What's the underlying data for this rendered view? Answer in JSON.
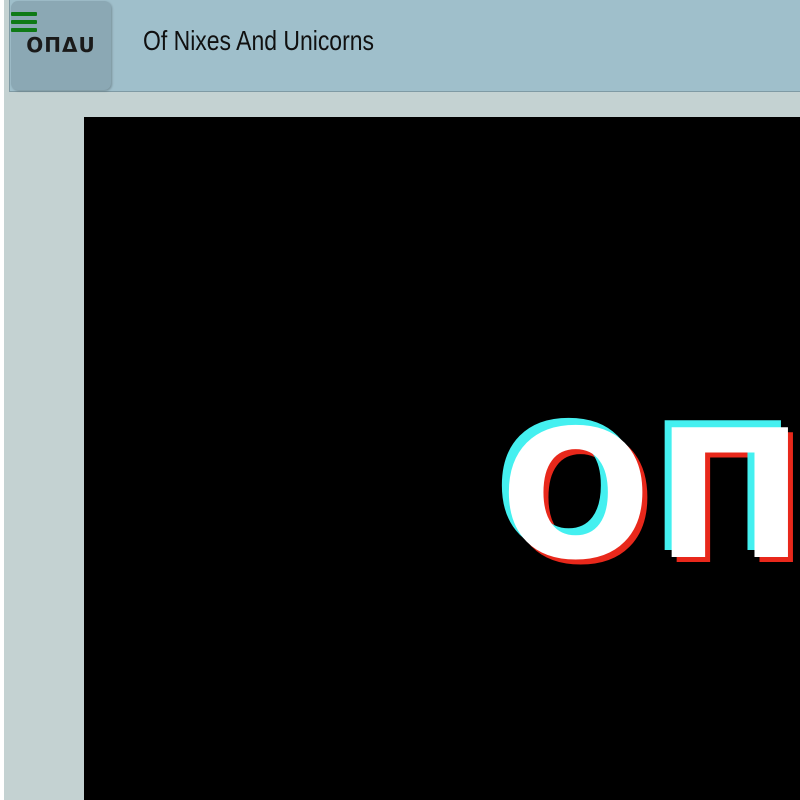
{
  "header": {
    "logo_text": "ΟΠΔU",
    "menu_icon": "hamburger-menu-icon",
    "site_title": "Of Nixes And Unicorns"
  },
  "hero": {
    "logo_text": "ΟΠΔU"
  },
  "colors": {
    "header_bg": "#9fbfcb",
    "page_bg": "#c4d2d2",
    "hero_bg": "#000000",
    "menu_icon": "#0f7a16",
    "hero_shadow_cyan": "#44f0f0",
    "hero_shadow_red": "#e8281b"
  }
}
